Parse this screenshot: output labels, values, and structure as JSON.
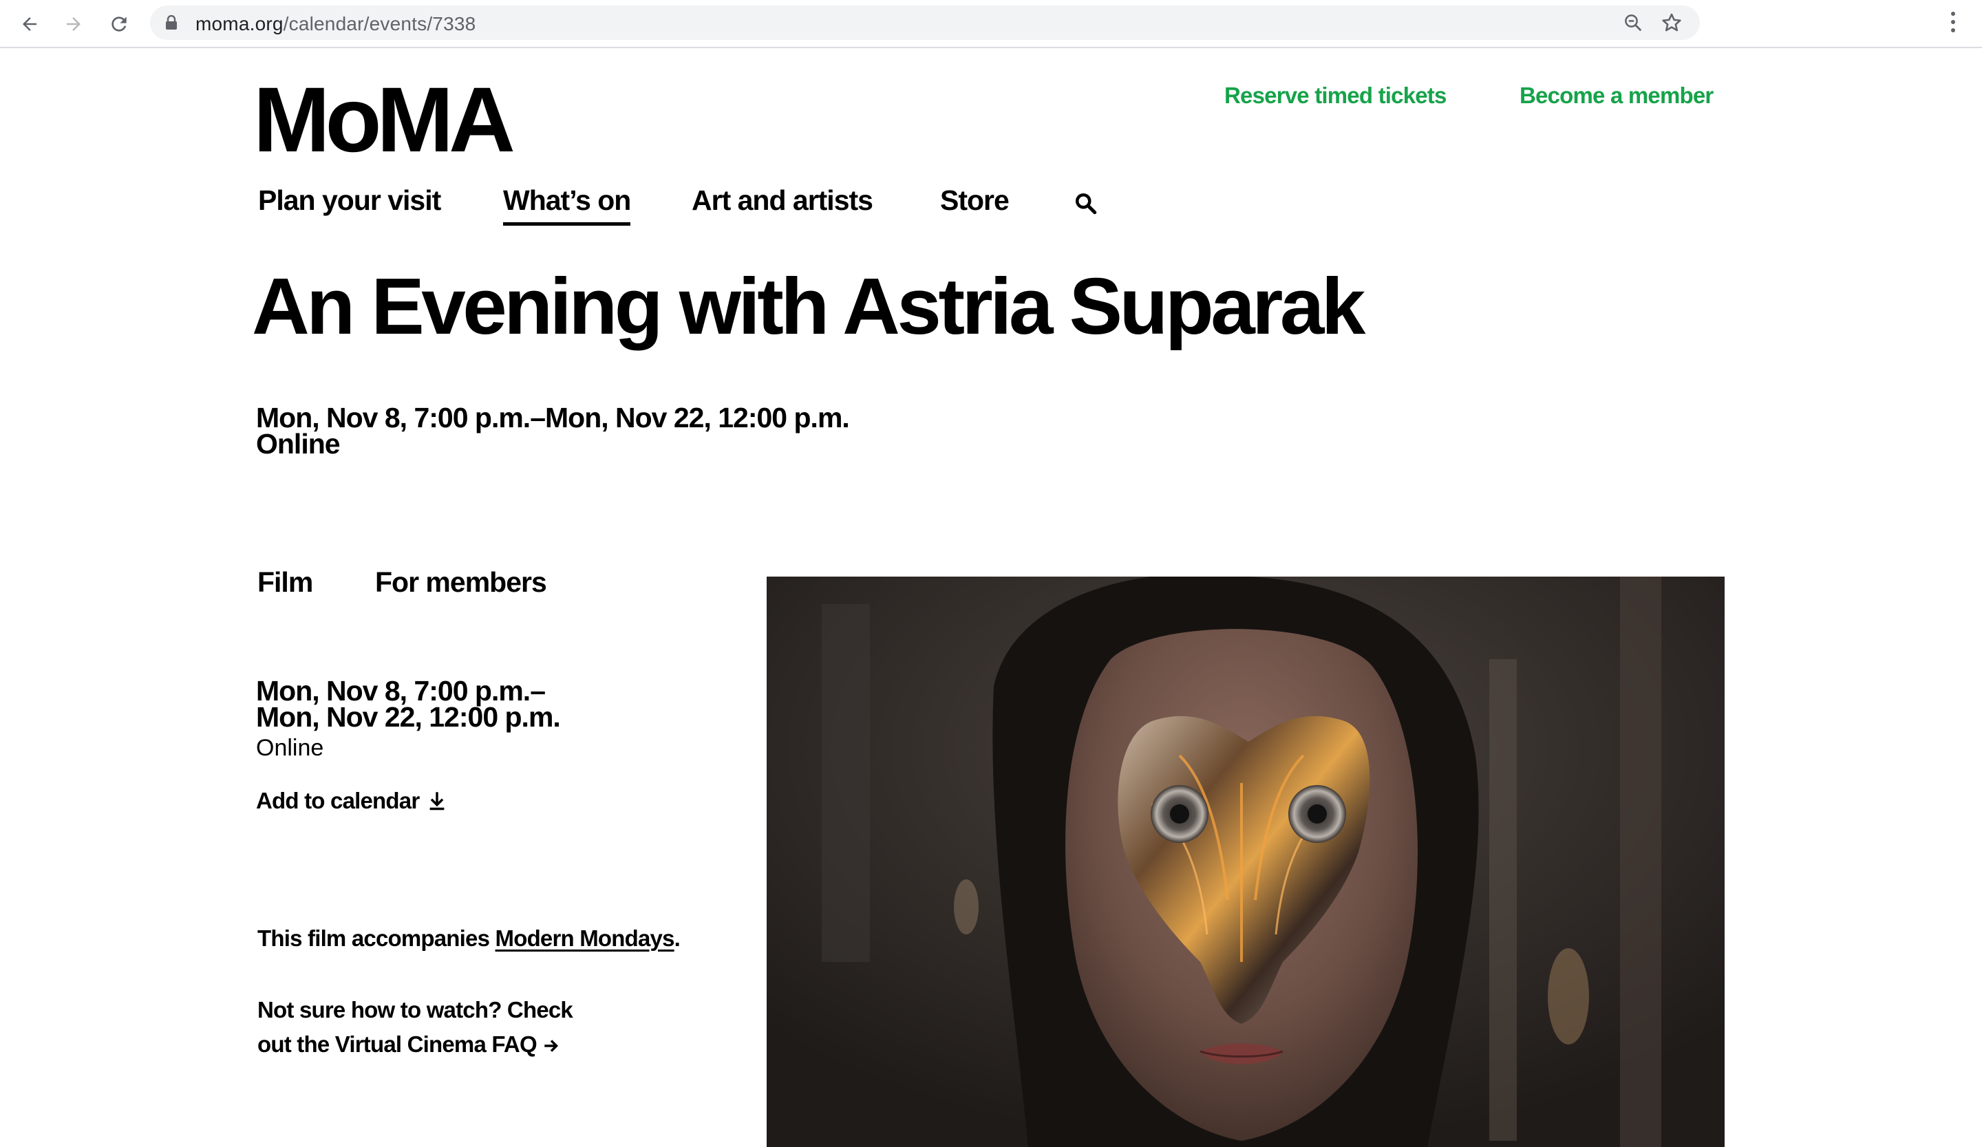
{
  "browser": {
    "url_host": "moma.org",
    "url_path": "/calendar/events/7338"
  },
  "header": {
    "logo": "MoMA",
    "reserve_label": "Reserve timed tickets",
    "member_label": "Become a member"
  },
  "nav": {
    "items": [
      {
        "label": "Plan your visit"
      },
      {
        "label": "What’s on"
      },
      {
        "label": "Art and artists"
      },
      {
        "label": "Store"
      }
    ]
  },
  "event": {
    "title": "An Evening with Astria Suparak",
    "date_range": "Mon, Nov 8, 7:00 p.m.–Mon, Nov 22, 12:00 p.m.",
    "location": "Online",
    "tags": [
      "Film",
      "For members"
    ],
    "side_date_start": "Mon, Nov 8, 7:00 p.m.–",
    "side_date_end": "Mon, Nov 22, 12:00 p.m.",
    "side_location": "Online",
    "add_to_calendar": "Add to calendar",
    "accompany_prefix": "This film accompanies ",
    "accompany_link": "Modern Mondays",
    "accompany_suffix": ".",
    "faq_line1": "Not sure how to watch? Check",
    "faq_line2": "out the Virtual Cinema FAQ"
  },
  "colors": {
    "accent_green": "#16a34a",
    "text": "#000000"
  }
}
